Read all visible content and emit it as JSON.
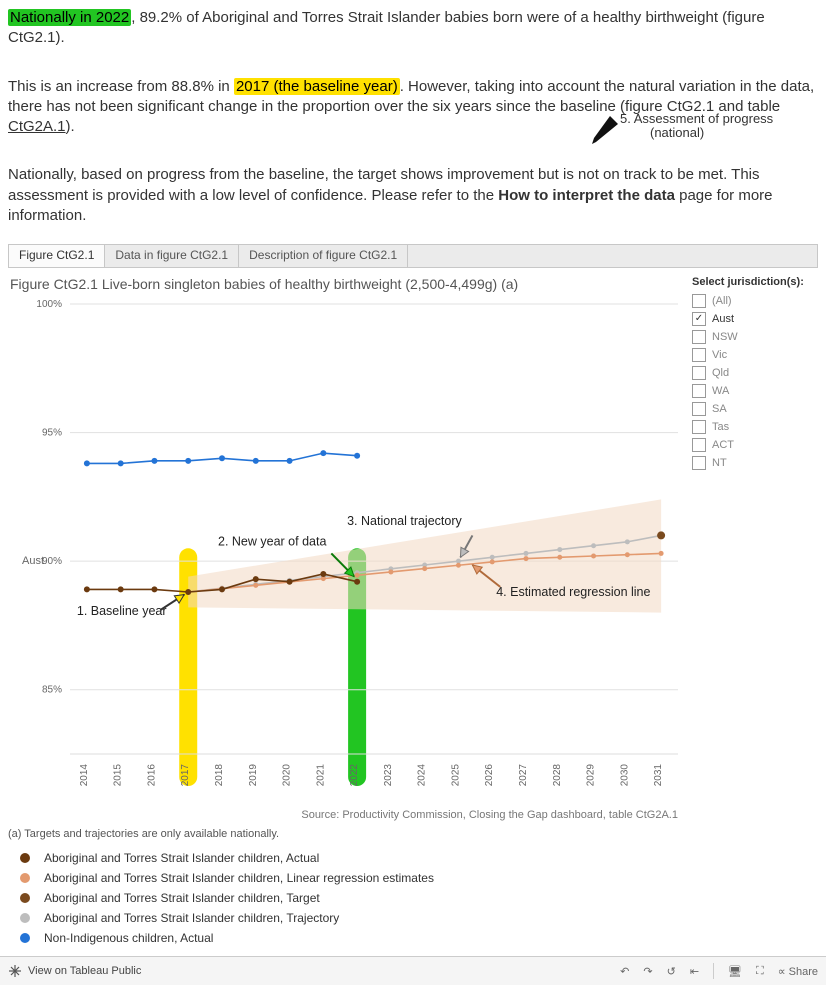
{
  "paragraphs": {
    "p1a": "Nationally in 2022",
    "p1b": ", 89.2% of Aboriginal and Torres Strait Islander babies born were of a healthy birthweight (figure CtG2.1).",
    "p2a": "This is an increase from 88.8% in ",
    "p2b": "2017 (the baseline year)",
    "p2c": ". However, taking into account the natural variation in the data, there has not been significant change in the proportion over the six years since the baseline (figure CtG2.1 and table ",
    "p2link": "CtG2A.1",
    "p2d": ").",
    "p3a": "Nationally, based on progress from the baseline, the target shows improvement but is not on track to be met. This assessment is provided with a low level of confidence. Please refer to the ",
    "p3b": "How to interpret the data",
    "p3c": " page for more information."
  },
  "tabs": {
    "t1": "Figure CtG2.1",
    "t2": "Data in figure CtG2.1",
    "t3": "Description of figure CtG2.1"
  },
  "chart_title": "Figure CtG2.1 Live-born singleton babies of healthy birthweight (2,500-4,499g) (a)",
  "picker": {
    "title": "Select jurisdiction(s):",
    "items": [
      "(All)",
      "Aust",
      "NSW",
      "Vic",
      "Qld",
      "WA",
      "SA",
      "Tas",
      "ACT",
      "NT"
    ],
    "checked": "Aust"
  },
  "annotations": {
    "a1": "1. Baseline year",
    "a2": "2. New year of data",
    "a3": "3. National trajectory",
    "a4": "4. Estimated regression line",
    "a5a": "5. Assessment of progress",
    "a5b": "(national)"
  },
  "axis_label": "Aust",
  "source": "Source: Productivity Commission, Closing the Gap dashboard, table CtG2A.1",
  "note": "(a) Targets and trajectories are only available nationally.",
  "legend": {
    "l1": "Aboriginal and Torres Strait Islander children, Actual",
    "l2": "Aboriginal and Torres Strait Islander children, Linear regression estimates",
    "l3": "Aboriginal and Torres Strait Islander children, Target",
    "l4": "Aboriginal and Torres Strait Islander children, Trajectory",
    "l5": "Non-Indigenous children, Actual"
  },
  "footer": {
    "view": "View on Tableau Public",
    "share": "Share"
  },
  "chart_data": {
    "type": "line",
    "title": "Figure CtG2.1 Live-born singleton babies of healthy birthweight (2,500-4,499g) (a)",
    "xlabel": "",
    "ylabel": "Aust",
    "ylim": [
      82.5,
      100
    ],
    "yticks": [
      85,
      90,
      95,
      100
    ],
    "x_years": [
      2014,
      2015,
      2016,
      2017,
      2018,
      2019,
      2020,
      2021,
      2022,
      2023,
      2024,
      2025,
      2026,
      2027,
      2028,
      2029,
      2030,
      2031
    ],
    "series": [
      {
        "name": "Aboriginal and Torres Strait Islander children, Actual",
        "color": "#6b3a0f",
        "x": [
          2014,
          2015,
          2016,
          2017,
          2018,
          2019,
          2020,
          2021,
          2022
        ],
        "values": [
          88.9,
          88.9,
          88.9,
          88.8,
          88.9,
          89.3,
          89.2,
          89.5,
          89.2
        ]
      },
      {
        "name": "Non-Indigenous children, Actual",
        "color": "#2373d6",
        "x": [
          2014,
          2015,
          2016,
          2017,
          2018,
          2019,
          2020,
          2021,
          2022
        ],
        "values": [
          93.8,
          93.8,
          93.9,
          93.9,
          94.0,
          93.9,
          93.9,
          94.2,
          94.1
        ]
      },
      {
        "name": "Aboriginal and Torres Strait Islander children, Trajectory",
        "color": "#bdbdbd",
        "x": [
          2017,
          2018,
          2019,
          2020,
          2021,
          2022,
          2023,
          2024,
          2025,
          2026,
          2027,
          2028,
          2029,
          2030,
          2031
        ],
        "values": [
          88.8,
          88.95,
          89.1,
          89.25,
          89.4,
          89.55,
          89.7,
          89.85,
          90.0,
          90.15,
          90.3,
          90.45,
          90.6,
          90.75,
          91.0
        ]
      },
      {
        "name": "Aboriginal and Torres Strait Islander children, Linear regression estimates",
        "color": "#e39a6f",
        "x": [
          2017,
          2018,
          2019,
          2020,
          2021,
          2022,
          2023,
          2024,
          2025,
          2026,
          2027,
          2028,
          2029,
          2030,
          2031
        ],
        "values": [
          88.8,
          88.93,
          89.06,
          89.19,
          89.32,
          89.45,
          89.58,
          89.71,
          89.84,
          89.97,
          90.1,
          90.15,
          90.2,
          90.25,
          90.3
        ]
      },
      {
        "name": "Aboriginal and Torres Strait Islander children, Target",
        "color": "#7a4a1e",
        "x": [
          2031
        ],
        "values": [
          91.0
        ]
      }
    ],
    "confidence_band": {
      "x": [
        2017,
        2031
      ],
      "upper": [
        89.4,
        92.4
      ],
      "lower": [
        88.2,
        88.0
      ]
    },
    "highlight_years": {
      "baseline": 2017,
      "new_data": 2022
    }
  }
}
